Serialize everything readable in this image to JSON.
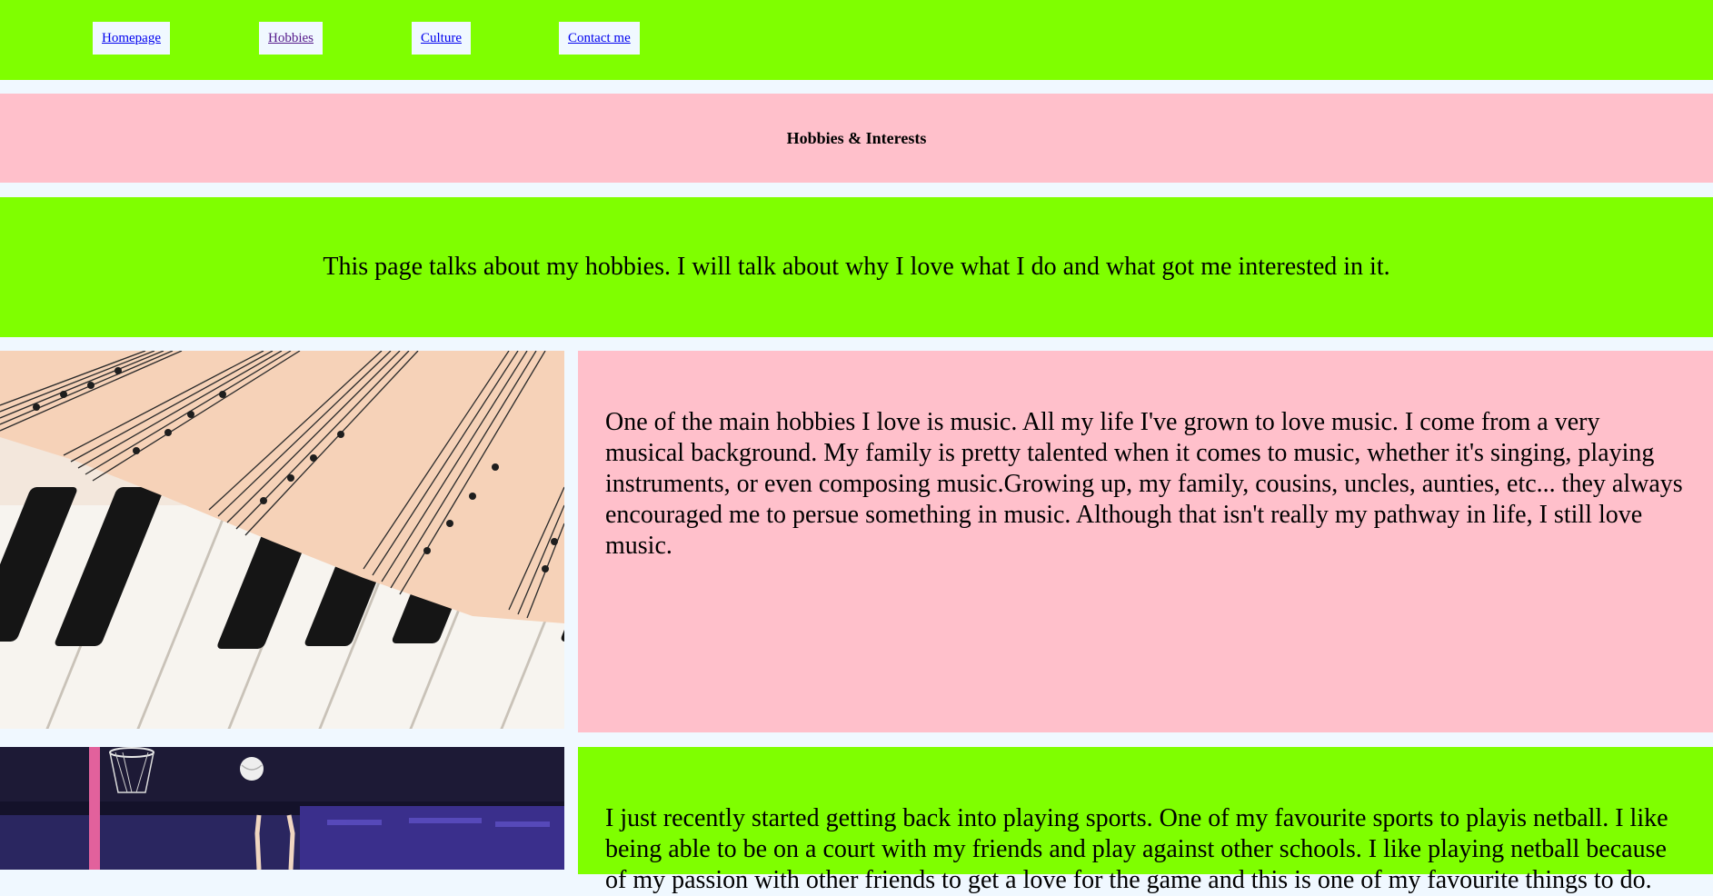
{
  "nav": {
    "items": [
      {
        "label": "Homepage"
      },
      {
        "label": "Hobbies"
      },
      {
        "label": "Culture"
      },
      {
        "label": "Contact me"
      }
    ]
  },
  "header": {
    "title": "Hobbies & Interests"
  },
  "intro": {
    "text": "This page talks about my hobbies. I will talk about why I love what I do and what got me interested in it."
  },
  "sections": [
    {
      "image": "piano-sheet-music-photo",
      "text": "One of the main hobbies I love is music. All my life I've grown to love music. I come from a very musical background. My family is pretty talented when it comes to music, whether it's singing, playing instruments, or even composing music.Growing up, my family, cousins, uncles, aunties, etc... they always encouraged me to persue something in music. Although that isn't really my pathway in life, I still love music."
    },
    {
      "image": "netball-game-photo",
      "text": "I just recently started getting back into playing sports. One of my favourite sports to playis netball. I like being able to be on a court with my friends and play against other schools. I like playing netball because of my passion with other friends to get a love for the game and this is one of my favourite things to do."
    }
  ],
  "colors": {
    "green": "#7fff00",
    "pink": "#ffc0cb",
    "background": "#f0f8ff",
    "link": "#0000ee",
    "visited_link": "#551a8b"
  }
}
